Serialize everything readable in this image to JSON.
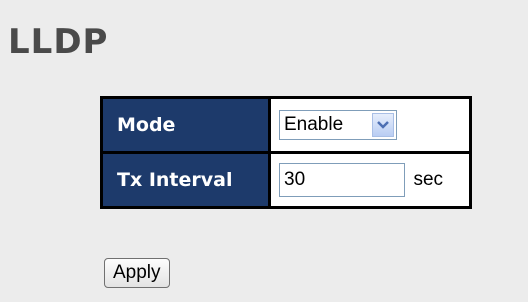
{
  "page": {
    "title": "LLDP"
  },
  "settings": {
    "mode": {
      "label": "Mode",
      "value": "Enable",
      "icon": "chevron-down-icon"
    },
    "tx_interval": {
      "label": "Tx Interval",
      "value": "30",
      "unit": "sec"
    }
  },
  "actions": {
    "apply_label": "Apply"
  },
  "colors": {
    "label_bg": "#1d3a6b",
    "page_bg": "#ececec",
    "arrow_color": "#4d6fb3"
  }
}
